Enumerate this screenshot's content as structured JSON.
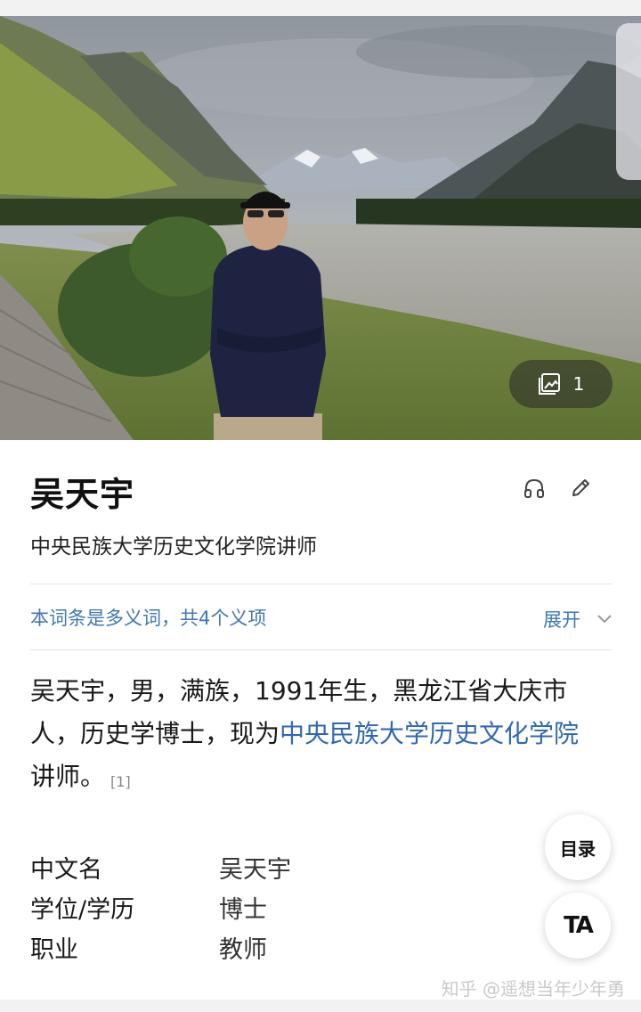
{
  "hero": {
    "gallery_count": "1",
    "icon": "gallery-icon"
  },
  "entry": {
    "title": "吴天宇",
    "subtitle": "中央民族大学历史文化学院讲师",
    "icons": [
      "headphones-icon",
      "edit-icon"
    ]
  },
  "polysemy": {
    "text": "本词条是多义词，共4个义项",
    "expand_label": "展开"
  },
  "description": {
    "part1": "吴天宇，男，满族，1991年生，黑龙江省大庆市人，历史学博士，现为",
    "link": "中央民族大学历史文化学院",
    "part2": "讲师。",
    "ref": "[1]"
  },
  "info": [
    {
      "key": "中文名",
      "value": "吴天宇"
    },
    {
      "key": "学位/学历",
      "value": "博士"
    },
    {
      "key": "职业",
      "value": "教师"
    }
  ],
  "buttons": {
    "toc": "目录",
    "ta": "TA"
  },
  "watermark": "知乎 @遥想当年少年勇",
  "colors": {
    "link": "#3168b5",
    "poly": "#3f78b3"
  }
}
